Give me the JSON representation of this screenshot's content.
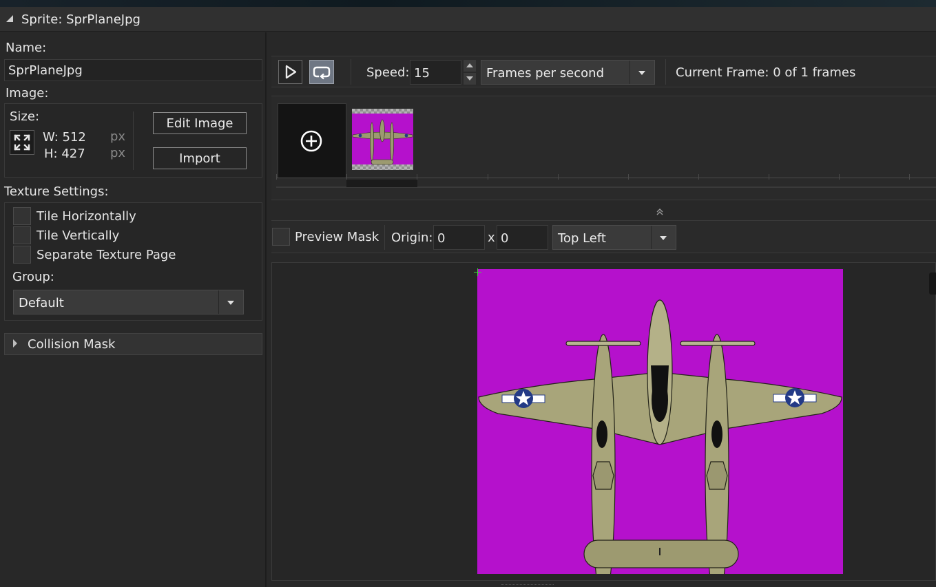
{
  "window": {
    "title": "Sprite: SprPlaneJpg"
  },
  "left": {
    "name_label": "Name:",
    "name_value": "SprPlaneJpg",
    "image_label": "Image:",
    "size_label": "Size:",
    "width_text": "W: 512",
    "height_text": "H: 427",
    "unit_w": "px",
    "unit_h": "px",
    "edit_image_label": "Edit Image",
    "import_label": "Import",
    "texture_settings_label": "Texture Settings:",
    "tile_h_label": "Tile Horizontally",
    "tile_v_label": "Tile Vertically",
    "separate_page_label": "Separate Texture Page",
    "group_label": "Group:",
    "group_value": "Default",
    "collision_mask_label": "Collision Mask"
  },
  "toolbar": {
    "speed_label": "Speed:",
    "speed_value": "15",
    "speed_unit": "Frames per second",
    "current_frame": "Current Frame: 0 of 1 frames"
  },
  "preview_bar": {
    "preview_mask_label": "Preview Mask",
    "origin_label": "Origin:",
    "origin_x": "0",
    "origin_sep": "x",
    "origin_y": "0",
    "origin_preset": "Top Left"
  },
  "colors": {
    "sprite_background": "#b511cc",
    "plane_body": "#a8a57a",
    "star_blue": "#233a86"
  },
  "icons": [
    "play-icon",
    "loop-icon",
    "add-frame-icon",
    "resize-icon",
    "collapse-up-icon",
    "dropdown-arrow-icon"
  ]
}
